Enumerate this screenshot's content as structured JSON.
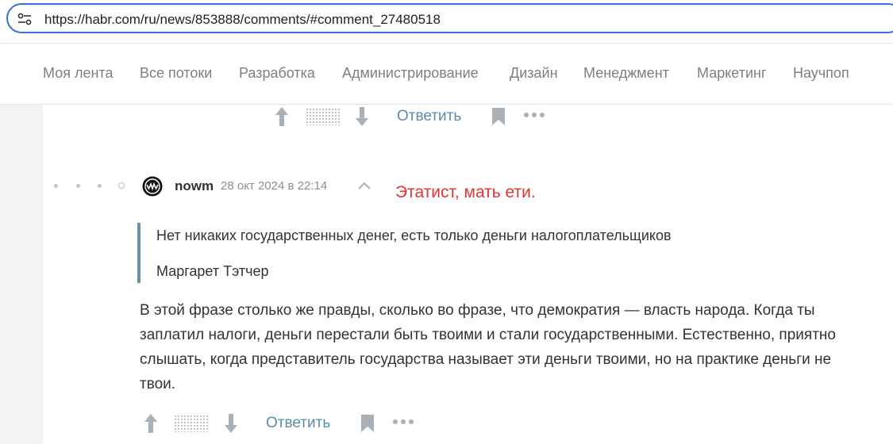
{
  "browser": {
    "url": "https://habr.com/ru/news/853888/comments/#comment_27480518"
  },
  "nav": {
    "items": [
      "Моя лента",
      "Все потоки",
      "Разработка",
      "Администрирование",
      "Дизайн",
      "Менеджмент",
      "Маркетинг",
      "Научпоп"
    ]
  },
  "top_actions": {
    "reply_label": "Ответить"
  },
  "comment": {
    "username": "nowm",
    "date": "28 окт 2024 в 22:14",
    "annotation": "Этатист, мать ети.",
    "quote": {
      "text": "Нет никаких государственных денег, есть только деньги налогоплательщиков",
      "author": "Маргарет Тэтчер"
    },
    "body": "В этой фразе столько же правды, сколько во фразе, что демократия — власть народа. Когда ты заплатил налоги, деньги перестали быть твоими и стали государственными. Естественно, приятно слышать, когда представитель государства называет эти деньги твоими, но на практике деньги не твои.",
    "actions": {
      "reply_label": "Ответить"
    }
  },
  "colors": {
    "accent": "#3b6fd8",
    "link": "#5b8ca8",
    "annotation": "#e5322d",
    "quote_border": "#6b8fa4"
  }
}
